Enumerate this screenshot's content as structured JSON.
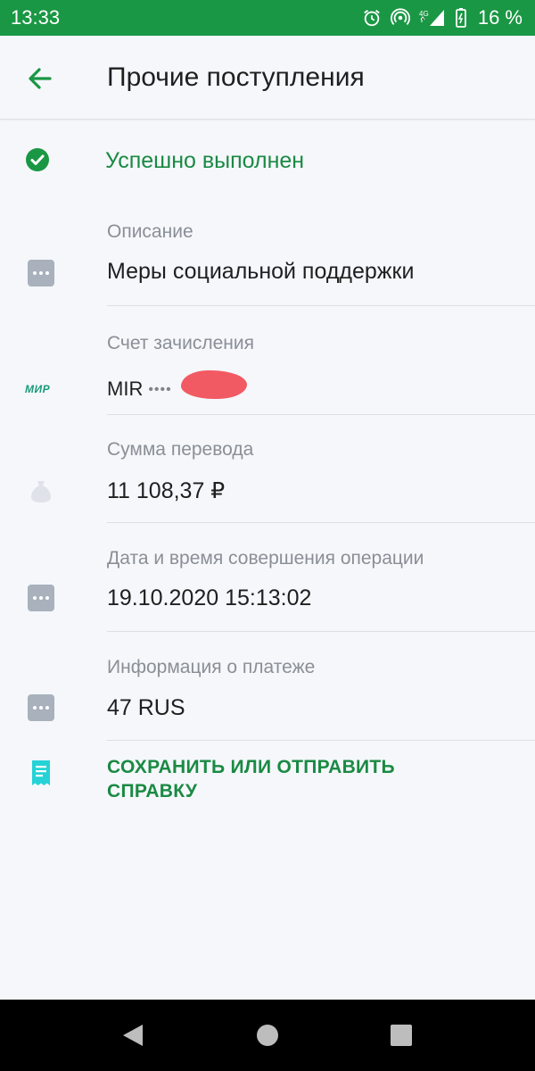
{
  "status_bar": {
    "time": "13:33",
    "battery": "16 %",
    "network": "4G"
  },
  "header": {
    "title": "Прочие поступления"
  },
  "operation_status": "Успешно выполнен",
  "fields": {
    "description": {
      "label": "Описание",
      "value": "Меры социальной поддержки"
    },
    "account": {
      "label": "Счет зачисления",
      "card_brand": "МИР",
      "value": "MIR",
      "mask": "••••"
    },
    "amount": {
      "label": "Сумма перевода",
      "value": "11 108,37 ₽"
    },
    "datetime": {
      "label": "Дата и время совершения операции",
      "value": "19.10.2020 15:13:02"
    },
    "payment_info": {
      "label": "Информация о платеже",
      "value": "47 RUS"
    }
  },
  "action": {
    "line1": "СОХРАНИТЬ ИЛИ ОТПРАВИТЬ",
    "line2": "СПРАВКУ"
  },
  "colors": {
    "status_bar": "#1a9744",
    "accent_green": "#1a8a43",
    "doc_icon": "#26d2d6",
    "redaction": "#f25a63"
  }
}
